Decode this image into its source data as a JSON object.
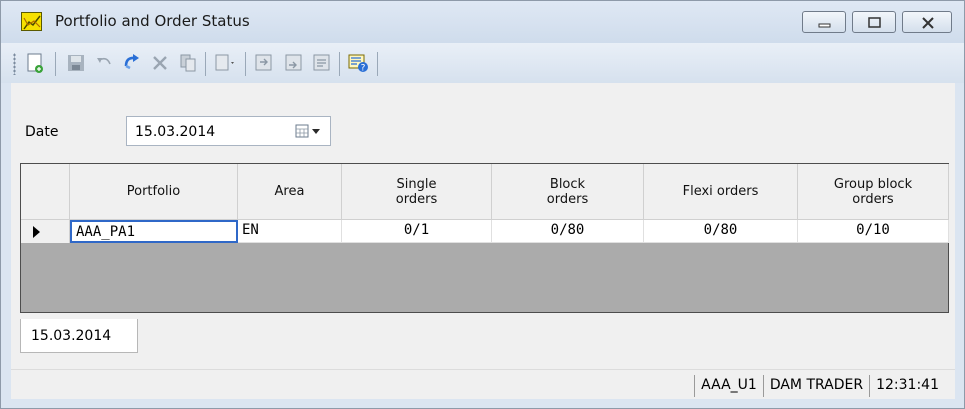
{
  "window": {
    "title": "Portfolio and Order Status",
    "controls": {
      "minimize": "minimize",
      "maximize": "maximize",
      "close": "close"
    }
  },
  "toolbar": {
    "items": [
      {
        "icon": "new-document-icon",
        "enabled": true
      },
      {
        "icon": "save-icon",
        "enabled": false
      },
      {
        "icon": "undo-icon",
        "enabled": false
      },
      {
        "icon": "refresh-icon",
        "enabled": true
      },
      {
        "icon": "delete-icon",
        "enabled": false
      },
      {
        "icon": "copy-icon",
        "enabled": false
      },
      {
        "icon": "import-icon",
        "enabled": false
      },
      {
        "icon": "export-icon",
        "enabled": false
      },
      {
        "icon": "send-icon",
        "enabled": false
      },
      {
        "icon": "report-icon",
        "enabled": false
      },
      {
        "icon": "help-icon",
        "enabled": true
      }
    ]
  },
  "filter": {
    "date_label": "Date",
    "date_value": "15.03.2014"
  },
  "grid": {
    "columns": [
      {
        "key": "portfolio",
        "label": "Portfolio"
      },
      {
        "key": "area",
        "label": "Area"
      },
      {
        "key": "single",
        "label": "Single\norders"
      },
      {
        "key": "block",
        "label": "Block\norders"
      },
      {
        "key": "flexi",
        "label": "Flexi orders"
      },
      {
        "key": "group_block",
        "label": "Group block\norders"
      }
    ],
    "rows": [
      {
        "portfolio": "AAA_PA1",
        "area": "EN",
        "single": "0/1",
        "block": "0/80",
        "flexi": "0/80",
        "group_block": "0/10"
      }
    ]
  },
  "tabs": [
    {
      "label": "15.03.2014",
      "active": true
    }
  ],
  "statusbar": {
    "user": "AAA_U1",
    "role": "DAM TRADER",
    "time": "12:31:41"
  },
  "colors": {
    "title_bg": "#d7e2f0",
    "selection_border": "#2f68c8",
    "grid_bg": "#ababab"
  }
}
